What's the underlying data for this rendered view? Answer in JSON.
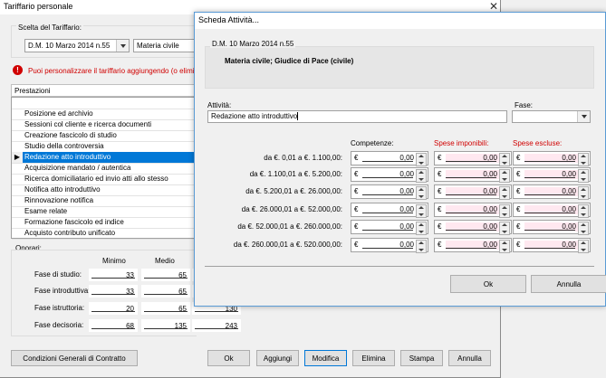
{
  "main_window": {
    "title": "Tariffario personale",
    "section_label": "Scelta del Tariffario:",
    "tariffario_value": "D.M. 10 Marzo 2014 n.55",
    "materia_value": "Materia civile",
    "info_text": "Puoi personalizzare il tariffario aggiungendo (o elimi",
    "prestazioni_header": "Prestazioni",
    "prestazioni": [
      "Posizione ed archivio",
      "Sessioni col cliente e ricerca documenti",
      "Creazione fascicolo di studio",
      "Studio della controversia",
      "Redazione atto introduttivo",
      "Acquisizione mandato / autentica",
      "Ricerca domiciliatario ed invio atti allo stesso",
      "Notifica atto introduttivo",
      "Rinnovazione notifica",
      "Esame relate",
      "Formazione fascicolo ed indice",
      "Acquisto contributo unificato"
    ],
    "selected_index": 4,
    "onorari_label": "Onorari:",
    "col_minimo": "Minimo",
    "col_medio": "Medio",
    "fasi": [
      {
        "label": "Fase di studio:",
        "minimo": "33",
        "medio": "65",
        "max": ""
      },
      {
        "label": "Fase introduttiva:",
        "minimo": "33",
        "medio": "65",
        "max": ""
      },
      {
        "label": "Fase istruttoria:",
        "minimo": "20",
        "medio": "65",
        "max": "130"
      },
      {
        "label": "Fase decisoria:",
        "minimo": "68",
        "medio": "135",
        "max": "243"
      }
    ],
    "buttons": {
      "condizioni": "Condizioni Generali di Contratto",
      "ok": "Ok",
      "aggiungi": "Aggiungi",
      "modifica": "Modifica",
      "elimina": "Elimina",
      "stampa": "Stampa",
      "annulla": "Annulla"
    }
  },
  "dialog": {
    "title": "Scheda Attività...",
    "group_label": "D.M. 10 Marzo 2014 n.55",
    "group_text": "Materia civile; Giudice di Pace (civile)",
    "attivita_label": "Attività:",
    "attivita_value": "Redazione atto introduttivo",
    "fase_label": "Fase:",
    "fase_value": "",
    "col_competenze": "Competenze:",
    "col_imponibili": "Spese imponibili:",
    "col_escluse": "Spese escluse:",
    "currency": "€",
    "rows": [
      {
        "range": "da €. 0,01 a €. 1.100,00:",
        "competenze": "0,00",
        "imponibili": "0,00",
        "escluse": "0,00"
      },
      {
        "range": "da €. 1.100,01 a €. 5.200,00:",
        "competenze": "0,00",
        "imponibili": "0,00",
        "escluse": "0,00"
      },
      {
        "range": "da €. 5.200,01 a €. 26.000,00:",
        "competenze": "0,00",
        "imponibili": "0,00",
        "escluse": "0,00"
      },
      {
        "range": "da €. 26.000,01 a €. 52.000,00:",
        "competenze": "0,00",
        "imponibili": "0,00",
        "escluse": "0,00"
      },
      {
        "range": "da €. 52.000,01 a €. 260.000,00:",
        "competenze": "0,00",
        "imponibili": "0,00",
        "escluse": "0,00"
      },
      {
        "range": "da €. 260.000,01 a €. 520.000,00:",
        "competenze": "0,00",
        "imponibili": "0,00",
        "escluse": "0,00"
      }
    ],
    "ok_label": "Ok",
    "annulla_label": "Annulla"
  },
  "colors": {
    "accent": "#0078d7",
    "warning_red": "#d00000",
    "pink_field": "#ffe8f0"
  }
}
